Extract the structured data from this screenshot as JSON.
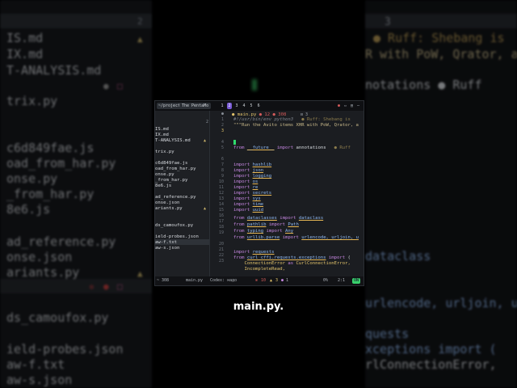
{
  "background_left": {
    "top_count": "2",
    "lines": [
      "IS.md",
      "IX.md",
      "T-ANALYSIS.md",
      "trix.py",
      "c6d849fae.js",
      "oad_from_har.py",
      "onse.py",
      "_from_har.py",
      "8e6.js",
      "ad_reference.py",
      "onse.json",
      "ariants.py",
      "ds_camoufox.py",
      "ield-probes.json",
      "aw-f.txt",
      "aw-s.json"
    ]
  },
  "background_right": {
    "tab_num": "3",
    "lines": [
      "● Ruff: Shebang is",
      "R with PoW, Qrator, a",
      "notations   ● Ruff",
      "dataclass",
      "urlencode, urljoin, u",
      "quests",
      "xceptions import (",
      "rlConnectionError,"
    ]
  },
  "window": {
    "tab_project": "~/projects/j",
    "tab_terminal": "The PentaMo",
    "workspace_pills": [
      "1",
      "2",
      "3",
      "4",
      "5",
      "6"
    ],
    "active_pill": "2",
    "sidebar": {
      "header_count": "2",
      "header_dot": "●",
      "files": [
        {
          "name": "IS.md",
          "mark": ""
        },
        {
          "name": "IX.md",
          "mark": ""
        },
        {
          "name": "T-ANALYSIS.md",
          "mark": "▲"
        },
        {
          "name": "",
          "mark": ""
        },
        {
          "name": "trix.py",
          "mark": ""
        },
        {
          "name": "",
          "mark": ""
        },
        {
          "name": "c6d849fae.js",
          "mark": ""
        },
        {
          "name": "oad_from_har.py",
          "mark": ""
        },
        {
          "name": "onse.py",
          "mark": ""
        },
        {
          "name": "_from_har.py",
          "mark": ""
        },
        {
          "name": "8e6.js",
          "mark": ""
        },
        {
          "name": "",
          "mark": ""
        },
        {
          "name": "ad_reference.py",
          "mark": ""
        },
        {
          "name": "onse.json",
          "mark": ""
        },
        {
          "name": "ariants.py",
          "mark": "▲"
        },
        {
          "name": "",
          "mark": ""
        },
        {
          "name": "",
          "mark": ""
        },
        {
          "name": "ds_camoufox.py",
          "mark": ""
        },
        {
          "name": "",
          "mark": ""
        },
        {
          "name": "ield-probes.json",
          "mark": ""
        },
        {
          "name": "aw-f.txt",
          "mark": ""
        },
        {
          "name": "aw-s.json",
          "mark": ""
        }
      ]
    },
    "editor": {
      "header_file": "● main.py",
      "header_info": "● 12 ● 308",
      "header_tab_num": "3",
      "line_numbers": [
        "1",
        "2",
        "3",
        "",
        "4",
        "5",
        "",
        "6",
        "7",
        "8",
        "9",
        "10",
        "11",
        "12",
        "13",
        "14",
        "15",
        "16",
        "17",
        "18",
        "19",
        "",
        "20",
        "21",
        "22",
        "23"
      ],
      "lines": {
        "shebang": "#!/usr/bin/env python3",
        "shebang_warning": "● Ruff: Shebang is",
        "docstring": "\"\"\"Run the Avito items XHR with PoW, Qrator, a",
        "future_kw": "from",
        "future_mod": "__future__",
        "future_import": "import",
        "future_name": "annotations",
        "future_warning": "● Ruff",
        "imports": [
          "hashlib",
          "json",
          "logging",
          "os",
          "re",
          "secrets",
          "sys",
          "time",
          "uuid"
        ],
        "from_lines": [
          {
            "mod": "dataclasses",
            "name": "dataclass"
          },
          {
            "mod": "pathlib",
            "name": "Path"
          },
          {
            "mod": "typing",
            "name": "Any"
          },
          {
            "mod": "urllib.parse",
            "name": "urlencode, urljoin, u"
          }
        ],
        "import_requests": "requests",
        "curl_exc_mod": "curl_cffi.requests.exceptions",
        "curl_exc_tail": "(",
        "curl_exc_1": "ConnectionError",
        "curl_exc_as": "as",
        "curl_exc_alias": "CurlConnectionError,",
        "curl_exc_2": "IncompleteRead,"
      }
    },
    "statusbar": {
      "position": "~ 308",
      "file": "main.py",
      "model": "Codex: надо",
      "errors": "10",
      "warnings": "3",
      "hints": "1",
      "percent": "0%",
      "cursor": "2:1",
      "mode": "ON"
    }
  },
  "caption": "main.py."
}
